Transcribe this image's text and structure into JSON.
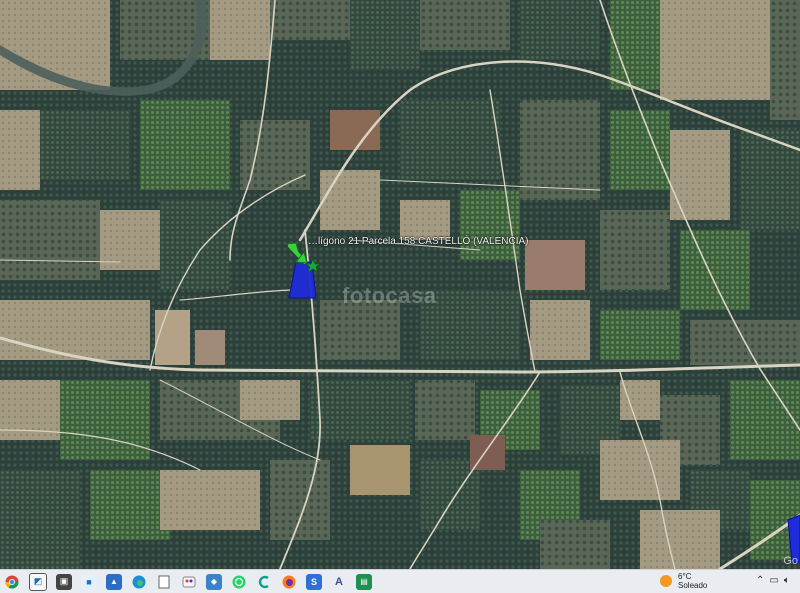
{
  "map": {
    "marker_label": "…lígono 21 Parcela 158 CASTELLÓ (VALENCIA)",
    "watermark": "fotocasa",
    "corner_logo": "Go",
    "parcel_color": "#1f2bd6",
    "marker_color": "#35d43a",
    "road_color": "#d9d3c2"
  },
  "taskbar": {
    "icons": [
      "chrome-icon",
      "explorer-window-icon",
      "snip-icon",
      "photo-icon",
      "edge-icon",
      "file-icon",
      "paint-icon",
      "whatsapp-icon",
      "app-c-icon",
      "firefox-icon",
      "store-icon",
      "acrobat-icon",
      "spreadsheet-icon"
    ],
    "weather": {
      "temp": "6°C",
      "condition": "Soleado"
    }
  }
}
